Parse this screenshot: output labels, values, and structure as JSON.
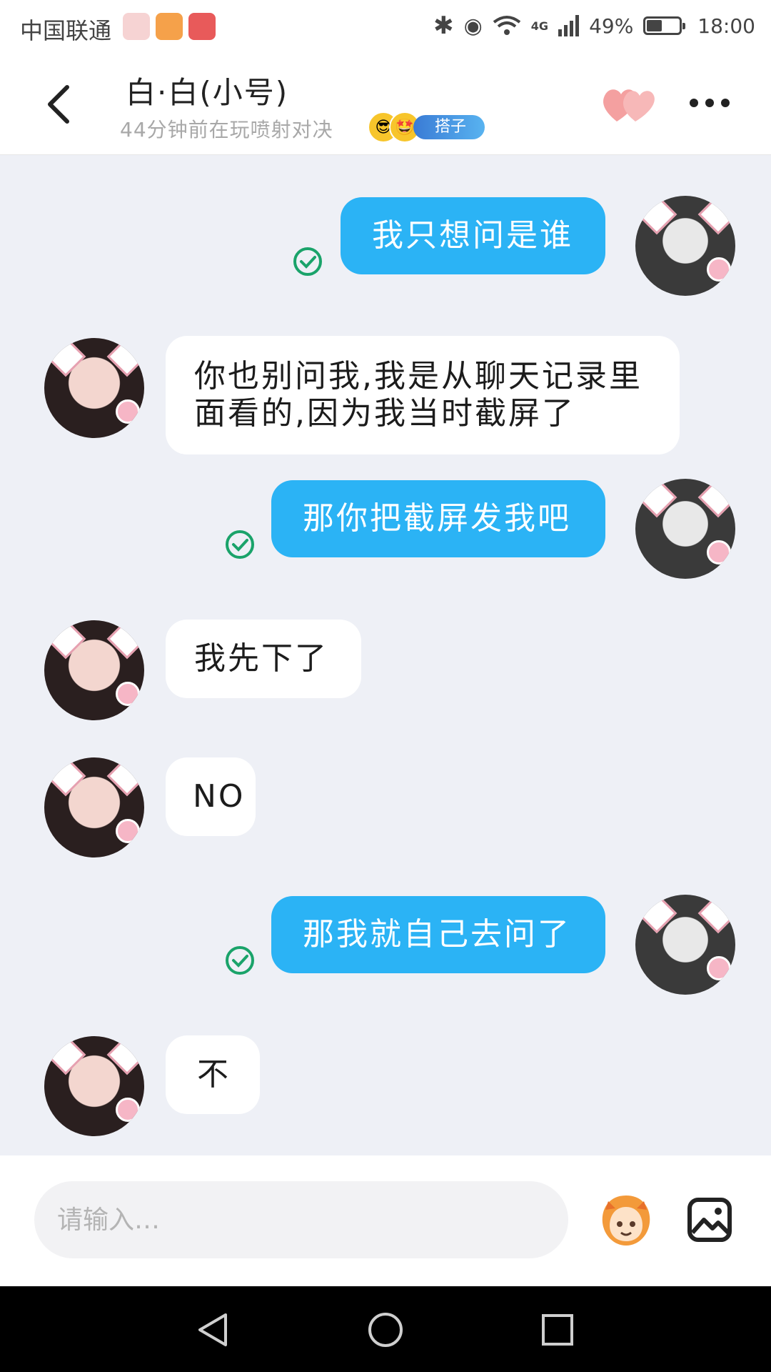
{
  "status_bar": {
    "carrier": "中国联通",
    "network": "4G",
    "battery": "49%",
    "battery_level": 0.49,
    "time": "18:00"
  },
  "header": {
    "title": "白·白(小号)",
    "subtitle": "44分钟前在玩喷射对决",
    "tag": "搭子"
  },
  "messages": [
    {
      "side": "out",
      "text": "我只想问是谁"
    },
    {
      "side": "in",
      "text": "你也别问我,我是从聊天记录里面看的,因为我当时截屏了"
    },
    {
      "side": "out",
      "text": "那你把截屏发我吧"
    },
    {
      "side": "in",
      "text": "我先下了"
    },
    {
      "side": "in",
      "text": "NO"
    },
    {
      "side": "out",
      "text": "那我就自己去问了"
    },
    {
      "side": "in",
      "text": "不"
    }
  ],
  "input": {
    "placeholder": "请输入…"
  },
  "colors": {
    "outgoing_bubble": "#2bb3f5",
    "incoming_bubble": "#ffffff",
    "background": "#eef0f6",
    "check": "#1aa36a"
  }
}
